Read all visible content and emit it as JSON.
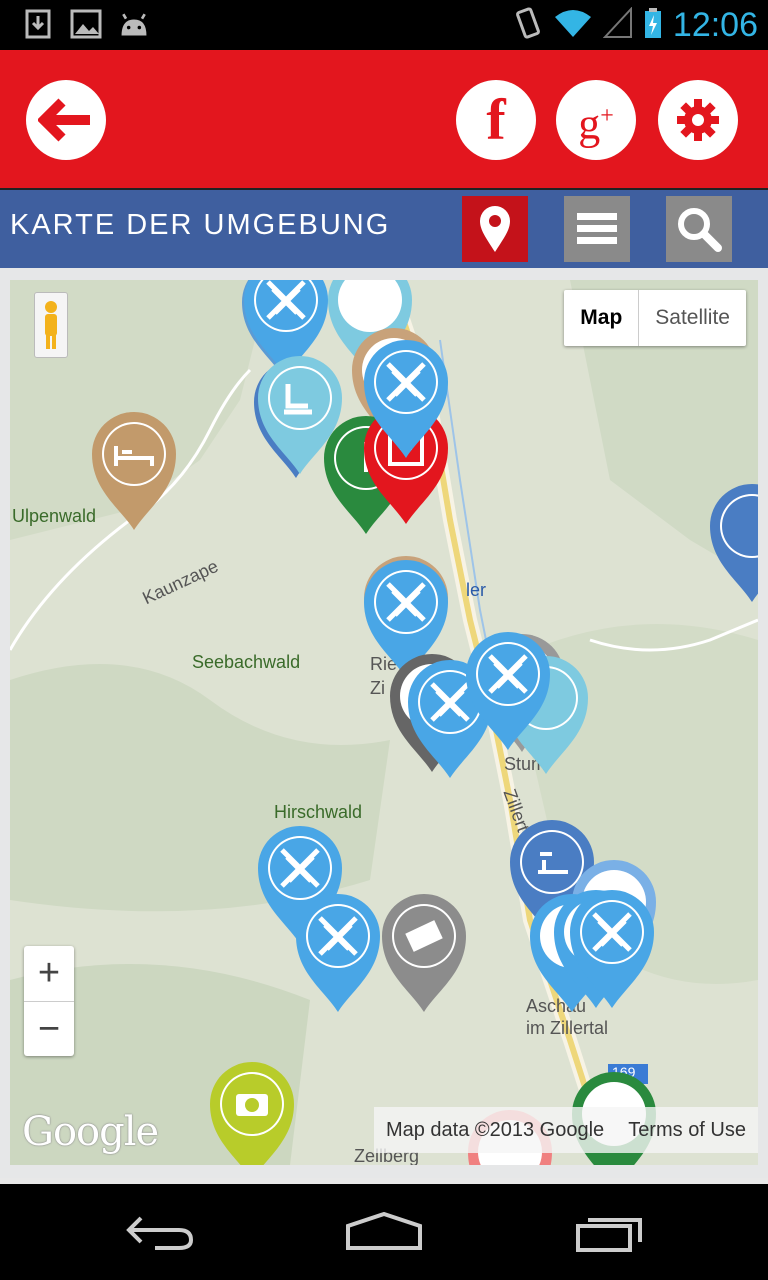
{
  "status_bar": {
    "time": "12:06",
    "icons": [
      "download-icon",
      "image-icon",
      "android-icon",
      "vibrate-icon",
      "wifi-icon",
      "signal-icon",
      "battery-charging-icon"
    ]
  },
  "header": {
    "back_icon": "back-arrow-icon",
    "facebook_label": "f",
    "googleplus_label": "g+",
    "settings_icon": "gear-icon",
    "color": "#e3161e"
  },
  "titlebar": {
    "title": "KARTE DER UMGEBUNG",
    "map_icon": "map-pin-icon",
    "list_icon": "list-icon",
    "search_icon": "search-icon",
    "color": "#3f5f9f"
  },
  "map": {
    "type_map": "Map",
    "type_satellite": "Satellite",
    "zoom_in": "+",
    "zoom_out": "−",
    "google_logo": "Google",
    "map_data": "Map data ©2013 Google",
    "terms": "Terms of Use",
    "places": {
      "ulpenwald": "Ulpenwald",
      "kaunzape": "Kaunzape",
      "seebachwald": "Seebachwald",
      "hirschwald": "Hirschwald",
      "aschau": "Aschau",
      "im_zillertal": "im Zillertal",
      "zellberg": "Zellberg",
      "ler": "ler",
      "rie": "Rie",
      "zi": "Zi",
      "stum": "Stum",
      "zillert": "Zillert",
      "road_169": "169"
    }
  }
}
